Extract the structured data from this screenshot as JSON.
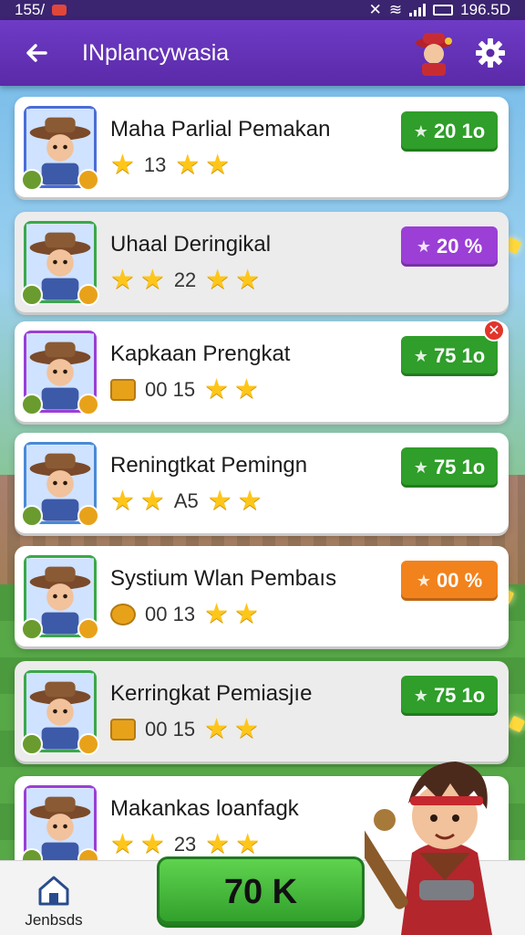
{
  "status_bar": {
    "left_text": "155/",
    "right_text": "196.5D"
  },
  "header": {
    "title": "INplancywasia"
  },
  "rows": [
    {
      "title": "Maha Parlial Pemakan",
      "meta_num": "13",
      "meta_icon": "none",
      "reward": "20 1o",
      "reward_color": "#2f9e2a",
      "frame": "#4a6dd6",
      "alt": false,
      "stars_before": 1,
      "stars_after": 2,
      "close": false
    },
    {
      "title": "Uhaal Deringikal",
      "meta_num": "22",
      "meta_icon": "none",
      "reward": "20 %",
      "reward_color": "#9b3fd6",
      "frame": "#3aa84a",
      "alt": true,
      "stars_before": 2,
      "stars_after": 2,
      "close": false
    },
    {
      "title": "Kapkaan Prengkat",
      "meta_num": "00 15",
      "meta_icon": "chest",
      "reward": "75 1o",
      "reward_color": "#2f9e2a",
      "frame": "#9b3fd6",
      "alt": false,
      "stars_before": 0,
      "stars_after": 2,
      "close": true
    },
    {
      "title": "Reningtkat Pemingn",
      "meta_num": "A5",
      "meta_icon": "none",
      "reward": "75 1o",
      "reward_color": "#2f9e2a",
      "frame": "#4a8ad6",
      "alt": false,
      "stars_before": 2,
      "stars_after": 2,
      "close": false
    },
    {
      "title": "Systium Wlan Pembaıs",
      "meta_num": "00 13",
      "meta_icon": "coin",
      "reward": "00 %",
      "reward_color": "#f2821c",
      "frame": "#3aa84a",
      "alt": false,
      "stars_before": 0,
      "stars_after": 2,
      "close": false
    },
    {
      "title": "Kerringkat Pemiasjıe",
      "meta_num": "00 15",
      "meta_icon": "chest",
      "reward": "75 1o",
      "reward_color": "#2f9e2a",
      "frame": "#3aa84a",
      "alt": true,
      "stars_before": 0,
      "stars_after": 2,
      "close": false
    },
    {
      "title": "Makankas loanfagk",
      "meta_num": "23",
      "meta_icon": "none",
      "reward": "",
      "reward_color": "",
      "frame": "#9b3fd6",
      "alt": false,
      "stars_before": 2,
      "stars_after": 2,
      "close": false
    }
  ],
  "bottom_bar": {
    "home_label": "Jenbsds",
    "cta_label": "70 K"
  },
  "icons": {
    "back": "arrow-left-icon",
    "settings": "gear-icon",
    "home": "home-icon",
    "star": "star-icon",
    "close": "close-icon"
  }
}
